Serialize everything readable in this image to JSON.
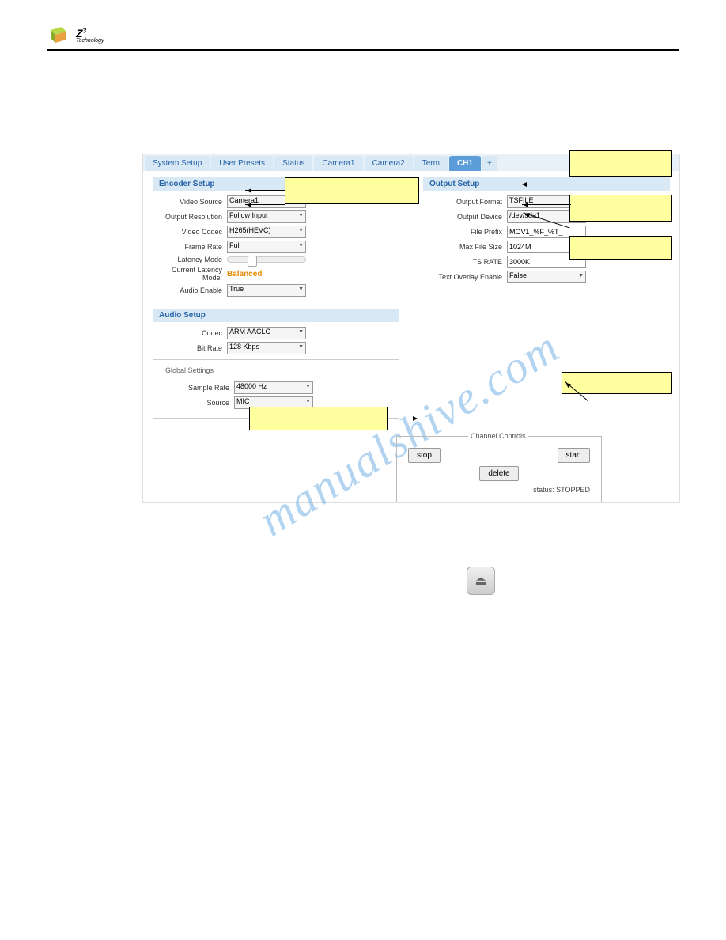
{
  "header": {
    "brand": "Z",
    "sup": "3",
    "sub": "Technology"
  },
  "tabs": {
    "t1": "System Setup",
    "t2": "User Presets",
    "t3": "Status",
    "t4": "Camera1",
    "t5": "Camera2",
    "t6": "Term",
    "t7": "CH1",
    "plus": "+"
  },
  "encoder": {
    "head": "Encoder Setup",
    "videoSourceLbl": "Video Source",
    "videoSource": "Camera1",
    "outResLbl": "Output Resolution",
    "outRes": "Follow Input",
    "vcodecLbl": "Video Codec",
    "vcodec": "H265(HEVC)",
    "frameRateLbl": "Frame Rate",
    "frameRate": "Full",
    "latencyLbl": "Latency Mode",
    "curLatLbl": "Current Latency Mode:",
    "curLat": "Balanced",
    "audioEnLbl": "Audio Enable",
    "audioEn": "True"
  },
  "output": {
    "head": "Output Setup",
    "formatLbl": "Output Format",
    "format": "TSFILE",
    "deviceLbl": "Output Device",
    "device": "/dev/sda1",
    "prefixLbl": "File Prefix",
    "prefix": "MOV1_%F_%T_",
    "maxSizeLbl": "Max File Size",
    "maxSize": "1024M",
    "tsRateLbl": "TS RATE",
    "tsRate": "3000K",
    "overlayLbl": "Text Overlay Enable",
    "overlay": "False"
  },
  "audio": {
    "head": "Audio Setup",
    "codecLbl": "Codec",
    "codec": "ARM AACLC",
    "bitRateLbl": "Bit Rate",
    "bitRate": "128 Kbps",
    "globalLbl": "Global Settings",
    "sampleLbl": "Sample Rate",
    "sample": "48000 Hz",
    "sourceLbl": "Source",
    "source": "MIC"
  },
  "controls": {
    "head": "Channel Controls",
    "stop": "stop",
    "start": "start",
    "delete": "delete",
    "status": "status: STOPPED"
  },
  "eject": "⏏"
}
